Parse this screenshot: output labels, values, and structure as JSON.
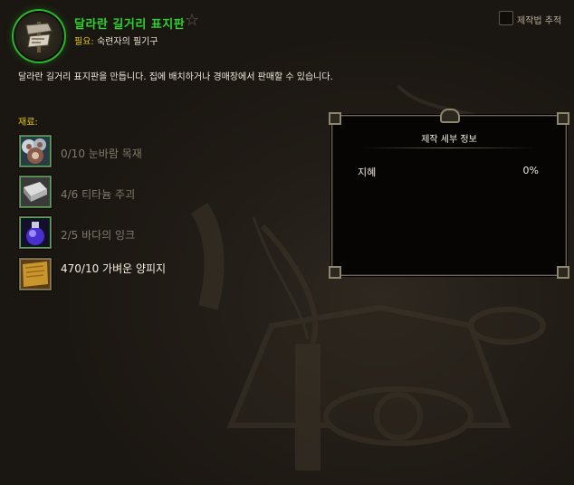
{
  "recipe": {
    "title": "달라란 길거리 표지판",
    "requires_label": "필요:",
    "requires_value": "숙련자의 필기구",
    "description": "달라란 길거리 표지판을 만듭니다. 집에 배치하거나 경매장에서 판매할 수 있습니다.",
    "icon": "street-sign-icon",
    "quality_color": "#2ed12e"
  },
  "track_recipe": {
    "label": "제작법 추적",
    "checked": false
  },
  "reagents": {
    "header": "재료:",
    "items": [
      {
        "label": "0/10 눈바람 목재",
        "icon": "snowwind-wood-icon",
        "sufficient": false
      },
      {
        "label": "4/6 티타늄 주괴",
        "icon": "titanium-bar-icon",
        "sufficient": false
      },
      {
        "label": "2/5 바다의 잉크",
        "icon": "ink-bottle-icon",
        "sufficient": false
      },
      {
        "label": "470/10 가벼운 양피지",
        "icon": "parchment-icon",
        "sufficient": true
      }
    ]
  },
  "details": {
    "title": "제작 세부 정보",
    "stats": [
      {
        "name": "지혜",
        "value": "0%"
      }
    ]
  },
  "colors": {
    "header_gold": "#e4c700",
    "insufficient_text": "#817a6c",
    "sufficient_text": "#f4efe2"
  }
}
